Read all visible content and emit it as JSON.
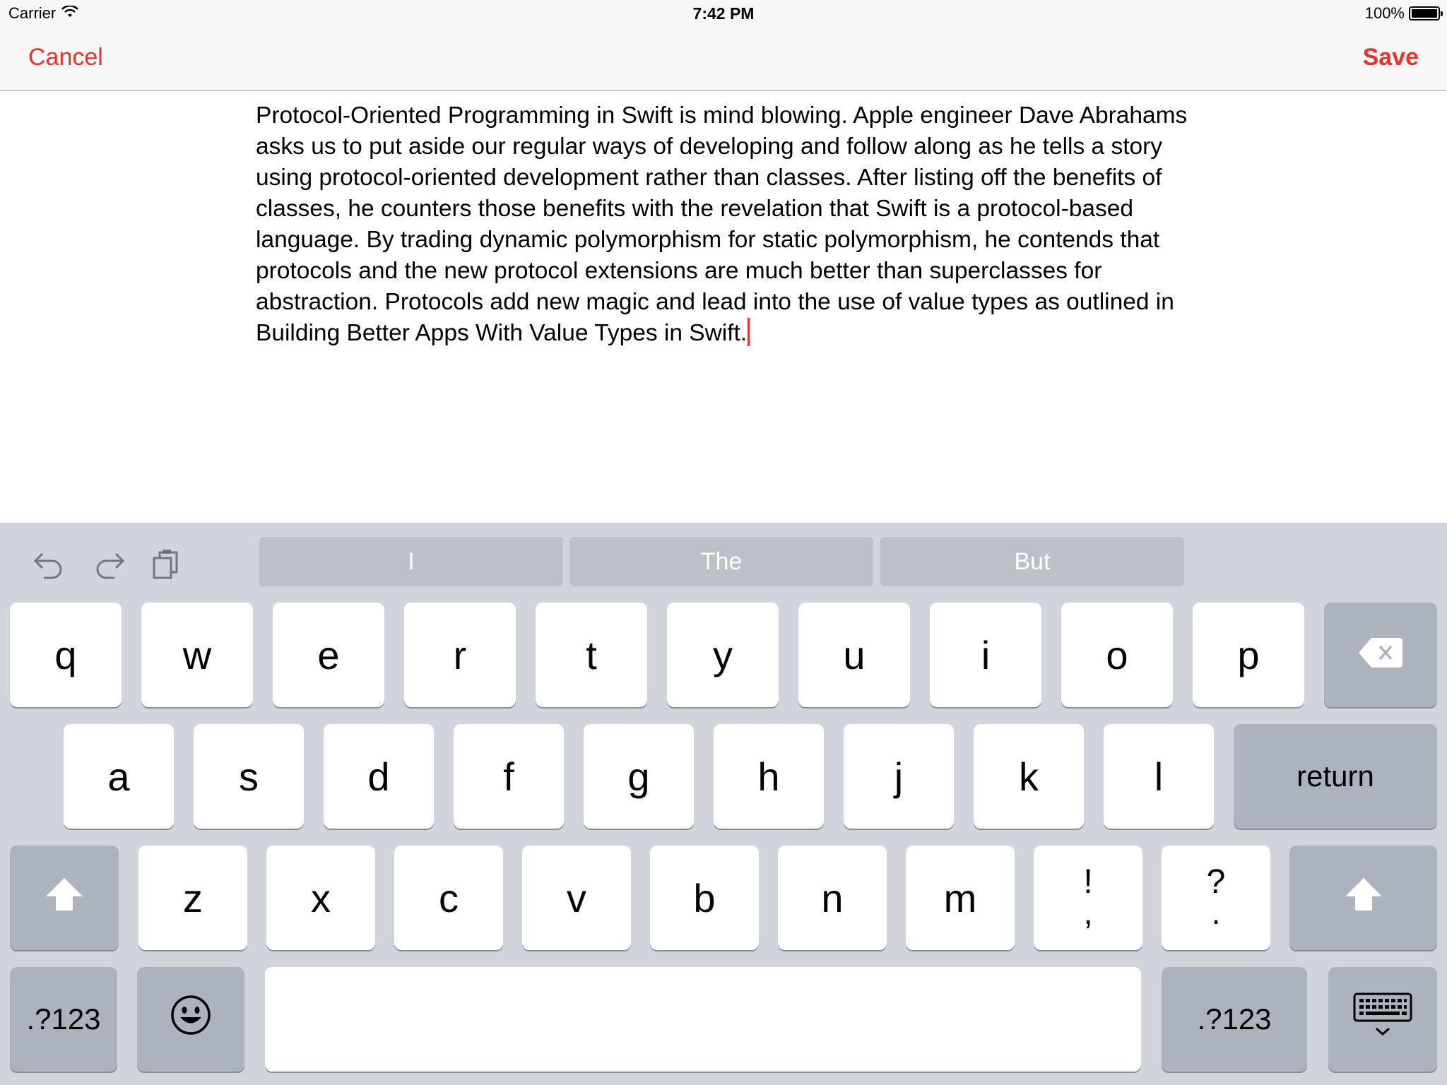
{
  "status_bar": {
    "carrier": "Carrier",
    "time": "7:42 PM",
    "battery": "100%"
  },
  "nav": {
    "cancel": "Cancel",
    "save": "Save"
  },
  "editor": {
    "text": "Protocol-Oriented Programming in Swift is mind blowing. Apple engineer Dave Abrahams asks us to put aside our regular ways of developing and follow along as he tells a story using protocol-oriented development rather than classes. After listing off the benefits of classes, he counters those benefits with the revelation that Swift is a protocol-based language. By trading dynamic polymorphism for static polymorphism, he contends that protocols and the new protocol extensions are much better than superclasses for abstraction. Protocols add new magic and lead into the use of value types as outlined in Building Better Apps With Value Types in Swift."
  },
  "keyboard": {
    "toolbar_icons": [
      "undo-icon",
      "redo-icon",
      "paste-icon"
    ],
    "suggestions": [
      "I",
      "The",
      "But"
    ],
    "row1": [
      "q",
      "w",
      "e",
      "r",
      "t",
      "y",
      "u",
      "i",
      "o",
      "p"
    ],
    "row2": [
      "a",
      "s",
      "d",
      "f",
      "g",
      "h",
      "j",
      "k",
      "l"
    ],
    "return_label": "return",
    "row3": [
      "z",
      "x",
      "c",
      "v",
      "b",
      "n",
      "m"
    ],
    "punct1": {
      "top": "!",
      "bottom": ","
    },
    "punct2": {
      "top": "?",
      "bottom": "."
    },
    "numbers_label": ".?123",
    "icons": {
      "delete": "delete-icon",
      "shift": "shift-icon",
      "emoji": "emoji-icon",
      "dismiss": "keyboard-dismiss-icon"
    },
    "colors": {
      "accent": "#e8322b",
      "keyboard_bg": "#d1d5db",
      "key_bg": "#ffffff",
      "function_key_bg": "#acb3bd",
      "suggestion_bg": "#bcc1c7"
    }
  }
}
